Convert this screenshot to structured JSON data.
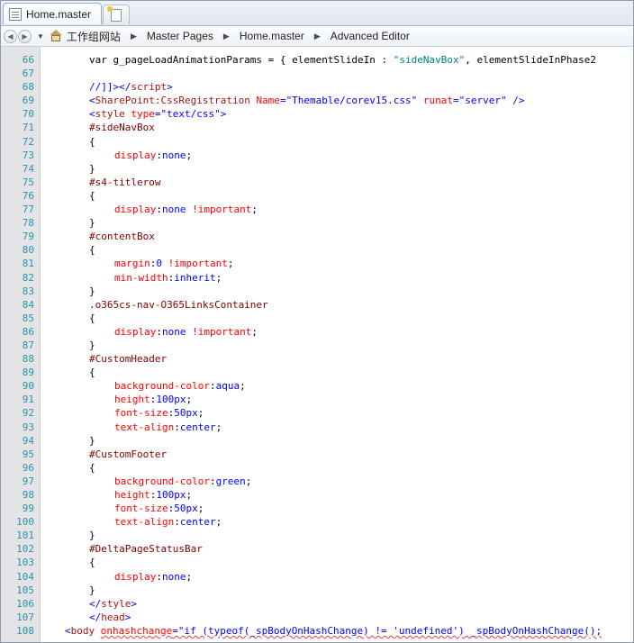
{
  "tab": {
    "label": "Home.master",
    "icon": "document-icon"
  },
  "new_tab": {
    "icon": "new-tab-icon"
  },
  "breadcrumb": {
    "items": [
      "工作组网站",
      "Master Pages",
      "Home.master",
      "Advanced Editor"
    ]
  },
  "colors": {
    "gutter": "#e4e4e4",
    "line_number": "#2b91af",
    "tag": "#a31515",
    "attribute": "#ff0000",
    "attr_value": "#0000ff",
    "selector": "#800000",
    "css_property": "#ff0000",
    "css_value": "#0000ff"
  },
  "code_lines": [
    {
      "n": "66",
      "indent": 2,
      "tokens": [
        {
          "t": "var g_pageLoadAnimationParams = { elementSlideIn : ",
          "c": "plain"
        },
        {
          "t": "\"sideNavBox\"",
          "c": "strjs"
        },
        {
          "t": ", elementSlideInPhase2",
          "c": "plain"
        }
      ]
    },
    {
      "n": "67",
      "indent": 0,
      "tokens": []
    },
    {
      "n": "68",
      "indent": 2,
      "tokens": [
        {
          "t": "//]]>",
          "c": "comment"
        },
        {
          "t": "</",
          "c": "delim"
        },
        {
          "t": "script",
          "c": "tag"
        },
        {
          "t": ">",
          "c": "delim"
        }
      ]
    },
    {
      "n": "69",
      "indent": 2,
      "tokens": [
        {
          "t": "<",
          "c": "delim"
        },
        {
          "t": "SharePoint:CssRegistration ",
          "c": "tag"
        },
        {
          "t": "Name",
          "c": "attr"
        },
        {
          "t": "=",
          "c": "delim"
        },
        {
          "t": "\"Themable/corev15.css\"",
          "c": "str"
        },
        {
          "t": " ",
          "c": "plain"
        },
        {
          "t": "runat",
          "c": "attr"
        },
        {
          "t": "=",
          "c": "delim"
        },
        {
          "t": "\"server\"",
          "c": "str"
        },
        {
          "t": " />",
          "c": "delim"
        }
      ]
    },
    {
      "n": "70",
      "indent": 2,
      "tokens": [
        {
          "t": "<",
          "c": "delim"
        },
        {
          "t": "style ",
          "c": "tag"
        },
        {
          "t": "type",
          "c": "attr"
        },
        {
          "t": "=",
          "c": "delim"
        },
        {
          "t": "\"text/css\"",
          "c": "str"
        },
        {
          "t": ">",
          "c": "delim"
        }
      ]
    },
    {
      "n": "71",
      "indent": 2,
      "tokens": [
        {
          "t": "#sideNavBox",
          "c": "sel"
        }
      ]
    },
    {
      "n": "72",
      "indent": 2,
      "tokens": [
        {
          "t": "{",
          "c": "plain"
        }
      ]
    },
    {
      "n": "73",
      "indent": 3,
      "tokens": [
        {
          "t": "display",
          "c": "prop"
        },
        {
          "t": ":",
          "c": "plain"
        },
        {
          "t": "none",
          "c": "val"
        },
        {
          "t": ";",
          "c": "plain"
        }
      ]
    },
    {
      "n": "74",
      "indent": 2,
      "tokens": [
        {
          "t": "}",
          "c": "plain"
        }
      ]
    },
    {
      "n": "75",
      "indent": 2,
      "tokens": [
        {
          "t": "#s4-titlerow",
          "c": "sel"
        }
      ]
    },
    {
      "n": "76",
      "indent": 2,
      "tokens": [
        {
          "t": "{",
          "c": "plain"
        }
      ]
    },
    {
      "n": "77",
      "indent": 3,
      "tokens": [
        {
          "t": "display",
          "c": "prop"
        },
        {
          "t": ":",
          "c": "plain"
        },
        {
          "t": "none ",
          "c": "val"
        },
        {
          "t": "!important",
          "c": "prop"
        },
        {
          "t": ";",
          "c": "plain"
        }
      ]
    },
    {
      "n": "78",
      "indent": 2,
      "tokens": [
        {
          "t": "}",
          "c": "plain"
        }
      ]
    },
    {
      "n": "79",
      "indent": 2,
      "tokens": [
        {
          "t": "#contentBox",
          "c": "sel"
        }
      ]
    },
    {
      "n": "80",
      "indent": 2,
      "tokens": [
        {
          "t": "{",
          "c": "plain"
        }
      ]
    },
    {
      "n": "81",
      "indent": 3,
      "tokens": [
        {
          "t": "margin",
          "c": "prop"
        },
        {
          "t": ":",
          "c": "plain"
        },
        {
          "t": "0 ",
          "c": "val"
        },
        {
          "t": "!important",
          "c": "prop"
        },
        {
          "t": ";",
          "c": "plain"
        }
      ]
    },
    {
      "n": "82",
      "indent": 3,
      "tokens": [
        {
          "t": "min-width",
          "c": "prop"
        },
        {
          "t": ":",
          "c": "plain"
        },
        {
          "t": "inherit",
          "c": "val"
        },
        {
          "t": ";",
          "c": "plain"
        }
      ]
    },
    {
      "n": "83",
      "indent": 2,
      "tokens": [
        {
          "t": "}",
          "c": "plain"
        }
      ]
    },
    {
      "n": "84",
      "indent": 2,
      "tokens": [
        {
          "t": ".o365cs-nav-O365LinksContainer",
          "c": "sel"
        }
      ]
    },
    {
      "n": "85",
      "indent": 2,
      "tokens": [
        {
          "t": "{",
          "c": "plain"
        }
      ]
    },
    {
      "n": "86",
      "indent": 3,
      "tokens": [
        {
          "t": "display",
          "c": "prop"
        },
        {
          "t": ":",
          "c": "plain"
        },
        {
          "t": "none ",
          "c": "val"
        },
        {
          "t": "!important",
          "c": "prop"
        },
        {
          "t": ";",
          "c": "plain"
        }
      ]
    },
    {
      "n": "87",
      "indent": 2,
      "tokens": [
        {
          "t": "}",
          "c": "plain"
        }
      ]
    },
    {
      "n": "88",
      "indent": 2,
      "tokens": [
        {
          "t": "#CustomHeader",
          "c": "sel"
        }
      ]
    },
    {
      "n": "89",
      "indent": 2,
      "tokens": [
        {
          "t": "{",
          "c": "plain"
        }
      ]
    },
    {
      "n": "90",
      "indent": 3,
      "tokens": [
        {
          "t": "background-color",
          "c": "prop"
        },
        {
          "t": ":",
          "c": "plain"
        },
        {
          "t": "aqua",
          "c": "val"
        },
        {
          "t": ";",
          "c": "plain"
        }
      ]
    },
    {
      "n": "91",
      "indent": 3,
      "tokens": [
        {
          "t": "height",
          "c": "prop"
        },
        {
          "t": ":",
          "c": "plain"
        },
        {
          "t": "100px",
          "c": "val"
        },
        {
          "t": ";",
          "c": "plain"
        }
      ]
    },
    {
      "n": "92",
      "indent": 3,
      "tokens": [
        {
          "t": "font-size",
          "c": "prop"
        },
        {
          "t": ":",
          "c": "plain"
        },
        {
          "t": "50px",
          "c": "val"
        },
        {
          "t": ";",
          "c": "plain"
        }
      ]
    },
    {
      "n": "93",
      "indent": 3,
      "tokens": [
        {
          "t": "text-align",
          "c": "prop"
        },
        {
          "t": ":",
          "c": "plain"
        },
        {
          "t": "center",
          "c": "val"
        },
        {
          "t": ";",
          "c": "plain"
        }
      ]
    },
    {
      "n": "94",
      "indent": 2,
      "tokens": [
        {
          "t": "}",
          "c": "plain"
        }
      ]
    },
    {
      "n": "95",
      "indent": 2,
      "tokens": [
        {
          "t": "#CustomFooter",
          "c": "sel"
        }
      ]
    },
    {
      "n": "96",
      "indent": 2,
      "tokens": [
        {
          "t": "{",
          "c": "plain"
        }
      ]
    },
    {
      "n": "97",
      "indent": 3,
      "tokens": [
        {
          "t": "background-color",
          "c": "prop"
        },
        {
          "t": ":",
          "c": "plain"
        },
        {
          "t": "green",
          "c": "val"
        },
        {
          "t": ";",
          "c": "plain"
        }
      ]
    },
    {
      "n": "98",
      "indent": 3,
      "tokens": [
        {
          "t": "height",
          "c": "prop"
        },
        {
          "t": ":",
          "c": "plain"
        },
        {
          "t": "100px",
          "c": "val"
        },
        {
          "t": ";",
          "c": "plain"
        }
      ]
    },
    {
      "n": "99",
      "indent": 3,
      "tokens": [
        {
          "t": "font-size",
          "c": "prop"
        },
        {
          "t": ":",
          "c": "plain"
        },
        {
          "t": "50px",
          "c": "val"
        },
        {
          "t": ";",
          "c": "plain"
        }
      ]
    },
    {
      "n": "100",
      "indent": 3,
      "tokens": [
        {
          "t": "text-align",
          "c": "prop"
        },
        {
          "t": ":",
          "c": "plain"
        },
        {
          "t": "center",
          "c": "val"
        },
        {
          "t": ";",
          "c": "plain"
        }
      ]
    },
    {
      "n": "101",
      "indent": 2,
      "tokens": [
        {
          "t": "}",
          "c": "plain"
        }
      ]
    },
    {
      "n": "102",
      "indent": 2,
      "tokens": [
        {
          "t": "#DeltaPageStatusBar",
          "c": "sel"
        }
      ]
    },
    {
      "n": "103",
      "indent": 2,
      "tokens": [
        {
          "t": "{",
          "c": "plain"
        }
      ]
    },
    {
      "n": "104",
      "indent": 3,
      "tokens": [
        {
          "t": "display",
          "c": "prop"
        },
        {
          "t": ":",
          "c": "plain"
        },
        {
          "t": "none",
          "c": "val"
        },
        {
          "t": ";",
          "c": "plain"
        }
      ]
    },
    {
      "n": "105",
      "indent": 2,
      "tokens": [
        {
          "t": "}",
          "c": "plain"
        }
      ]
    },
    {
      "n": "106",
      "indent": 2,
      "tokens": [
        {
          "t": "</",
          "c": "delim"
        },
        {
          "t": "style",
          "c": "tag"
        },
        {
          "t": ">",
          "c": "delim"
        }
      ]
    },
    {
      "n": "107",
      "indent": 2,
      "tokens": [
        {
          "t": "</",
          "c": "delim"
        },
        {
          "t": "head",
          "c": "tag"
        },
        {
          "t": ">",
          "c": "delim"
        }
      ]
    },
    {
      "n": "108",
      "indent": 1,
      "tokens": [
        {
          "t": "<",
          "c": "delim"
        },
        {
          "t": "body ",
          "c": "tag"
        },
        {
          "t": "onhashchange",
          "c": "attr",
          "err": true
        },
        {
          "t": "=",
          "c": "delim",
          "err": true
        },
        {
          "t": "\"if (typeof(_spBodyOnHashChange) != 'undefined') _spBodyOnHashChange();",
          "c": "str",
          "err": true
        }
      ]
    }
  ]
}
